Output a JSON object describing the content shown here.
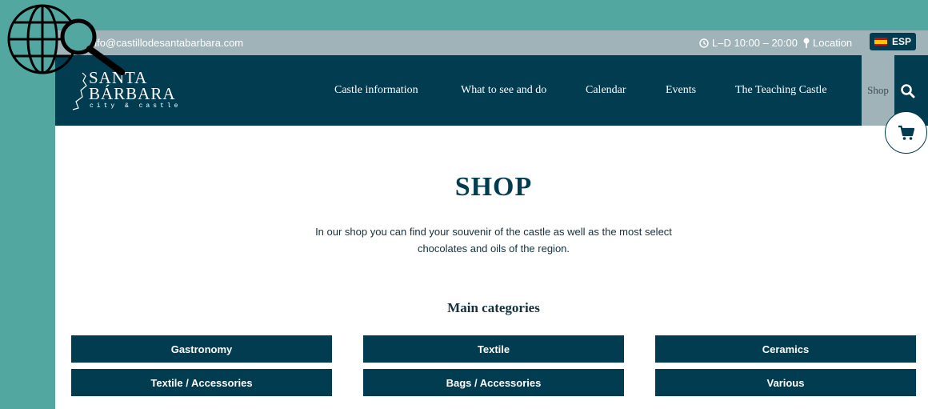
{
  "topbar": {
    "email": "info@castillodesantabarbara.com",
    "hours": "L–D 10:00 – 20:00",
    "location": "Location",
    "language": "ESP"
  },
  "logo": {
    "line1": "SANTA",
    "line2": "BÁRBARA",
    "tagline": "city & castle"
  },
  "nav": {
    "items": [
      {
        "label": "Castle information"
      },
      {
        "label": "What to see and do"
      },
      {
        "label": "Calendar"
      },
      {
        "label": "Events"
      },
      {
        "label": "The Teaching Castle"
      },
      {
        "label": "Shop"
      }
    ]
  },
  "page": {
    "title": "SHOP",
    "intro_line1": "In our shop you can find your souvenir of the castle as well as the most select",
    "intro_line2": "chocolates and oils of the region.",
    "categories_heading": "Main categories"
  },
  "categories": [
    {
      "label": "Gastronomy"
    },
    {
      "label": "Textile"
    },
    {
      "label": "Ceramics"
    },
    {
      "label": "Textile / Accessories"
    },
    {
      "label": "Bags / Accessories"
    },
    {
      "label": "Various"
    }
  ],
  "colors": {
    "brand": "#013c50",
    "topbar": "#a0b3b8",
    "background": "#52a8a1"
  },
  "icons": [
    "globe-search-icon",
    "envelope-icon",
    "clock-icon",
    "pin-icon",
    "spain-flag-icon",
    "search-icon",
    "cart-icon",
    "castle-outline-icon"
  ]
}
